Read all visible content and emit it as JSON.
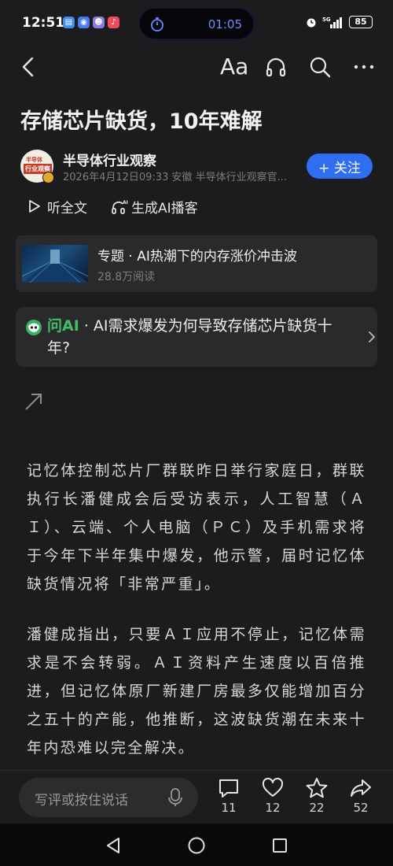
{
  "status_bar": {
    "time": "12:51",
    "timer": "01:05",
    "network": "5G",
    "battery": "85",
    "app_icons": [
      "files-app",
      "safari-like-app",
      "game-app",
      "music-app"
    ]
  },
  "nav": {
    "font_label": "Aa"
  },
  "article": {
    "title": "存储芯片缺货，10年难解",
    "author": {
      "name": "半导体行业观察",
      "avatar_line1": "半导体",
      "avatar_line2": "行业观察",
      "meta": "2026年4月12日09:33 安徽 半导体行业观察官..."
    },
    "follow_label": "+ 关注",
    "listen_label": "听全文",
    "podcast_label": "生成AI播客"
  },
  "topic": {
    "title": "专题 · AI热潮下的内存涨价冲击波",
    "reads": "28.8万阅读"
  },
  "ask_ai": {
    "brand": "问AI",
    "question": " · AI需求爆发为何导致存储芯片缺货十年?"
  },
  "body": {
    "paragraphs": [
      "记忆体控制芯片厂群联昨日举行家庭日，群联执行长潘健成会后受访表示，人工智慧（ＡＩ）、云端、个人电脑（ＰＣ）及手机需求将于今年下半年集中爆发，他示警，届时记忆体缺货情况将「非常严重」。",
      "潘健成指出，只要ＡＩ应用不停止，记忆体需求是不会转弱。ＡＩ资料产生速度以百倍推进，但记忆体原厂新建厂房最多仅能增加百分之五十的产能，他推断，这波缺货潮在未来十年内恐难以完全解决。"
    ]
  },
  "bottom_bar": {
    "comment_placeholder": "写评或按住说话",
    "comments": "11",
    "likes": "12",
    "favorites": "22",
    "shares": "52"
  },
  "colors": {
    "background": "#1c1c1e",
    "accent": "#2f6ef1",
    "ai_green": "#3fbf66",
    "timer_blue": "#6d8dff"
  }
}
